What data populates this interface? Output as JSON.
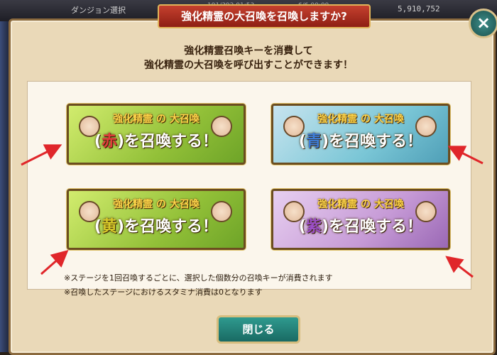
{
  "background": {
    "stage_label": "ダンジョン選択",
    "stat1": "191/392 01:53",
    "stat2": "6/6 00:00",
    "money": "5,910,752"
  },
  "dialog": {
    "title": "強化精霊の大召喚を召喚しますか?",
    "description_line1": "強化精霊召喚キーを消費して",
    "description_line2": "強化精霊の大召喚を呼び出すことができます！",
    "cards": [
      {
        "header": "強化精霊 の 大召喚",
        "color": "赤",
        "summon": ")を召喚する！",
        "theme": "green"
      },
      {
        "header": "強化精霊 の 大召喚",
        "color": "青",
        "summon": ")を召喚する！",
        "theme": "blue"
      },
      {
        "header": "強化精霊 の 大召喚",
        "color": "黄",
        "summon": ")を召喚する！",
        "theme": "green"
      },
      {
        "header": "強化精霊 の 大召喚",
        "color": "紫",
        "summon": ")を召喚する！",
        "theme": "purple"
      }
    ],
    "note1": "※ステージを1回召喚するごとに、選択した個数分の召喚キーが消費されます",
    "note2": "※召喚したステージにおけるスタミナ消費は0となります",
    "close_label": "閉じる",
    "close_icon": "×"
  },
  "colors": {
    "title_bg": "#b6392a",
    "arrow": "#e0262a",
    "close_button": "#2f8e86"
  }
}
